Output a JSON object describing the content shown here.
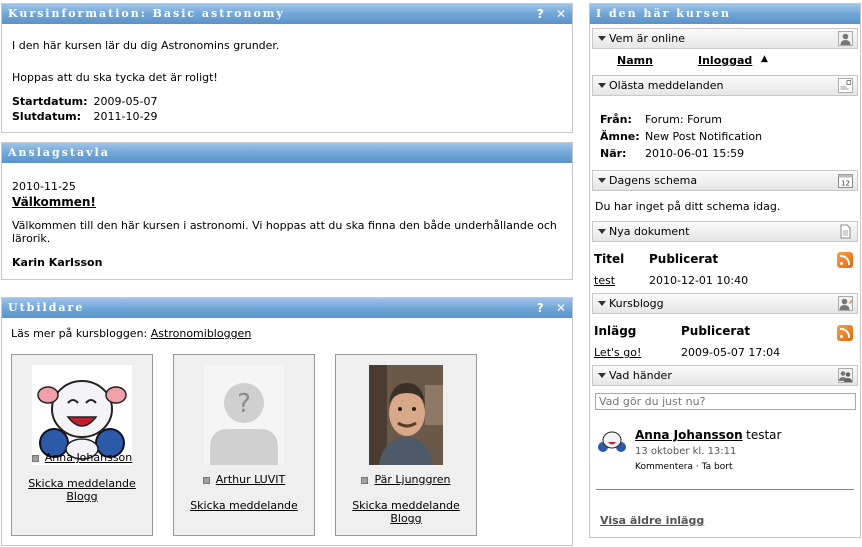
{
  "kursinfo": {
    "title": "Kursinformation: Basic astronomy",
    "intro": "I den här kursen lär du dig Astronomins grunder.",
    "hope": "Hoppas att du ska tycka det är roligt!",
    "start_label": "Startdatum:",
    "start_value": "2009-05-07",
    "end_label": "Slutdatum:",
    "end_value": "2011-10-29"
  },
  "anslag": {
    "title": "Anslagstavla",
    "date": "2010-11-25",
    "heading": "Välkommen!",
    "body": "Välkommen till den här kursen i astronomi. Vi hoppas att du ska finna den både underhållande och lärorik.",
    "author": "Karin Karlsson"
  },
  "utbildare": {
    "title": "Utbildare",
    "blog_prefix": "Läs mer på kursbloggen:",
    "blog_link": "Astronomibloggen",
    "teachers": [
      {
        "name": "Anna Johansson",
        "link1": "Skicka meddelande",
        "link2": "Blogg"
      },
      {
        "name": "Arthur LUVIT",
        "link1": "Skicka meddelande",
        "link2": ""
      },
      {
        "name": "Pär Ljunggren",
        "link1": "Skicka meddelande",
        "link2": "Blogg"
      }
    ]
  },
  "panel_tools": {
    "help": "?",
    "close": "✕"
  },
  "right": {
    "title": "I den här kursen",
    "online": {
      "label": "Vem är online",
      "col_name": "Namn",
      "col_login": "Inloggad"
    },
    "unread": {
      "label": "Olästa meddelanden",
      "from_label": "Från:",
      "from_value": "Forum: Forum",
      "subject_label": "Ämne:",
      "subject_value": "New Post Notification",
      "when_label": "När:",
      "when_value": "2010-06-01 15:59"
    },
    "schedule": {
      "label": "Dagens schema",
      "text": "Du har inget på ditt schema idag.",
      "cal_day": "12"
    },
    "docs": {
      "label": "Nya dokument",
      "col_title": "Titel",
      "col_pub": "Publicerat",
      "item": "test",
      "item_date": "2010-12-01 10:40"
    },
    "blog": {
      "label": "Kursblogg",
      "col_post": "Inlägg",
      "col_pub": "Publicerat",
      "item": "Let's go!",
      "item_date": "2009-05-07 17:04"
    },
    "happening": {
      "label": "Vad händer",
      "placeholder": "Vad gör du just nu?",
      "user": "Anna Johansson",
      "action": "testar",
      "time": "13 oktober kl. 13:11",
      "comment": "Kommentera",
      "sep": "·",
      "remove": "Ta bort",
      "older": "Visa äldre inlägg"
    }
  }
}
